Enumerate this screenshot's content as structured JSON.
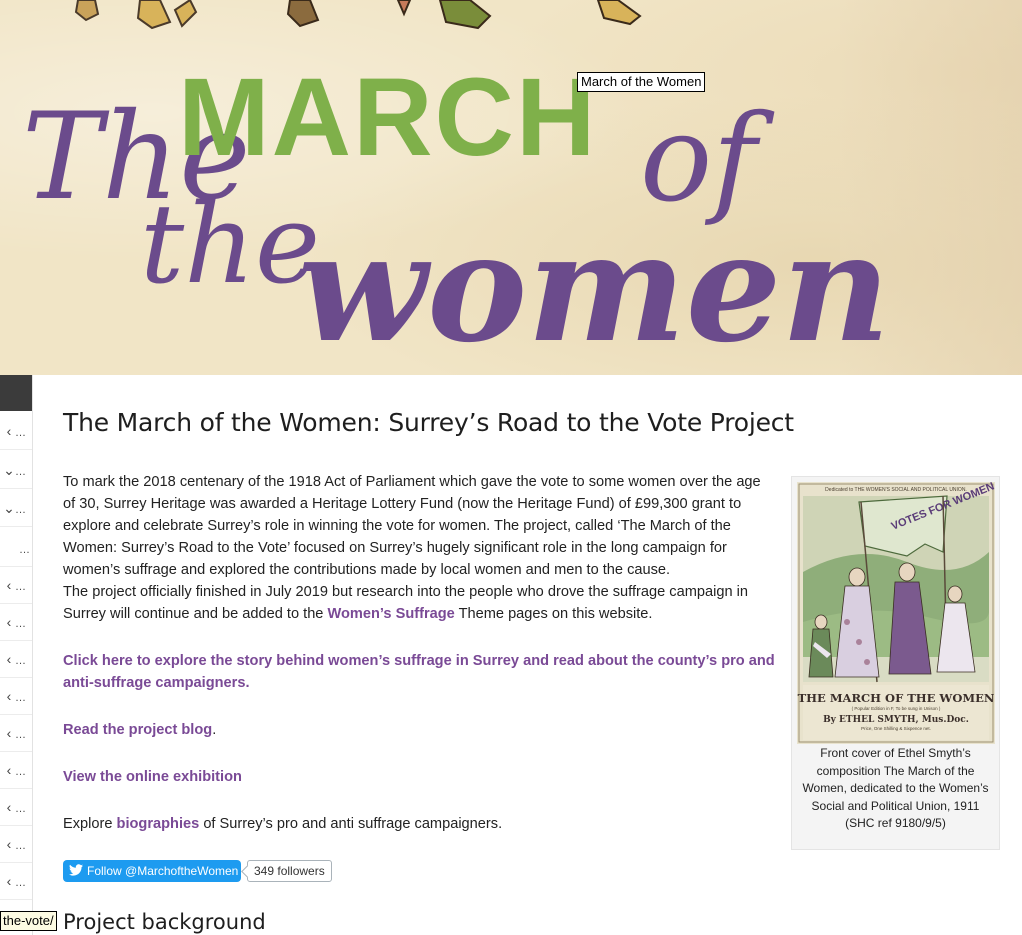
{
  "hero": {
    "title_word_the": "The",
    "title_word_march": "MARCH",
    "title_word_of": "of",
    "title_word_the2": "the",
    "title_word_women": "women",
    "tooltip": "March of the Women",
    "colors": {
      "purple": "#6b4b8c",
      "green": "#7fb04a",
      "background": "#f1e5c6"
    }
  },
  "sidebar": {
    "items": [
      {
        "chevron": "‹",
        "label": "…"
      },
      {
        "chevron": "⌄",
        "label": "…"
      },
      {
        "chevron": "⌄",
        "label": "…"
      },
      {
        "chevron": "",
        "label": "…"
      },
      {
        "chevron": "‹",
        "label": "…"
      },
      {
        "chevron": "‹",
        "label": "…"
      },
      {
        "chevron": "‹",
        "label": "…"
      },
      {
        "chevron": "‹",
        "label": "…"
      },
      {
        "chevron": "‹",
        "label": "…"
      },
      {
        "chevron": "‹",
        "label": "…"
      },
      {
        "chevron": "‹",
        "label": "…"
      },
      {
        "chevron": "‹",
        "label": "…"
      },
      {
        "chevron": "‹",
        "label": "…"
      }
    ]
  },
  "main": {
    "title": "The March of the Women: Surrey’s Road to the Vote Project",
    "intro": "To mark the 2018 centenary of the 1918 Act of Parliament which gave the vote to some women over the age of 30, Surrey Heritage was awarded a Heritage Lottery Fund (now the Heritage Fund) of £99,300 grant to explore and celebrate Surrey’s role in winning the vote for women. The project, called ‘The March of the Women: Surrey’s Road to the Vote’ focused on Surrey’s hugely significant role in the long campaign for women’s suffrage and explored the contributions made by local women and men to the cause.",
    "followup_before": "The project officially finished in July 2019 but research into the people who drove the suffrage campaign in Surrey will continue and be added to the ",
    "followup_link": "Women’s Suffrage",
    "followup_after": " Theme pages on this website.",
    "explore_link": "Click here to explore the story behind women’s suffrage in Surrey and read about the county’s pro and anti-suffrage campaigners.",
    "blog_link": "Read the project blog",
    "blog_after": ".",
    "exhibition_link": "View the online exhibition",
    "bio_before": "Explore ",
    "bio_link": "biographies",
    "bio_after": " of Surrey’s pro and anti suffrage campaigners.",
    "twitter_follow": "Follow @MarchoftheWomen",
    "twitter_count": "349 followers",
    "section_heading": "Project background",
    "link_color": "#7a4a96",
    "twitter_color": "#1d9bf0"
  },
  "figure": {
    "poster_top_text": "Dedicated to THE WOMEN'S SOCIAL AND POLITICAL UNION.",
    "poster_banner_text": "VOTES FOR WOMEN W.S.P.U.",
    "poster_title": "THE MARCH OF THE WOMEN",
    "poster_subtitle": "( Popular Edition in F, To be sung in Unison )",
    "poster_author": "By ETHEL SMYTH, Mus.Doc.",
    "poster_price": "Price, One Shilling & Sixpence net.",
    "caption": "Front cover of Ethel Smyth’s composition The March of the Women, dedicated to the Women’s Social and Political Union, 1911 (SHC ref 9180/9/5)"
  },
  "status": {
    "url_tooltip": "the-vote/"
  }
}
